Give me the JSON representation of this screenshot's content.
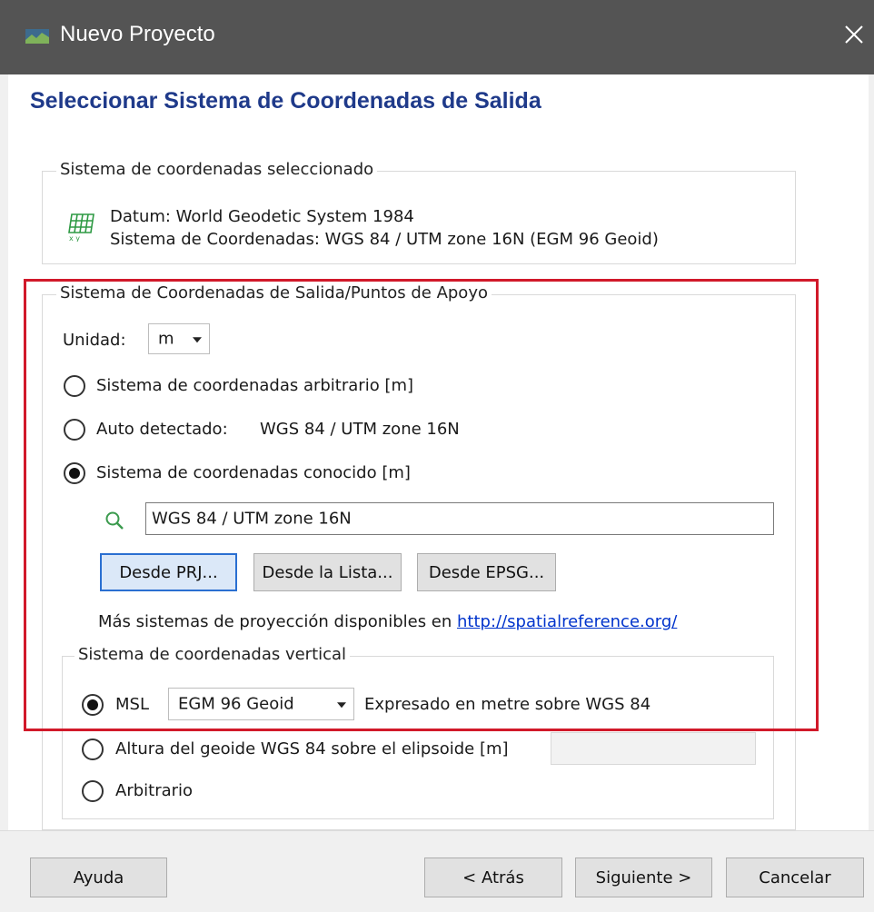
{
  "window": {
    "title": "Nuevo Proyecto"
  },
  "page_title": "Seleccionar Sistema de Coordenadas de Salida",
  "selected_group": {
    "caption": "Sistema de coordenadas seleccionado",
    "datum_line": "Datum: World Geodetic System 1984",
    "cs_line": "Sistema de Coordenadas: WGS 84 / UTM zone 16N (EGM 96 Geoid)",
    "icon": "coordinate-grid-icon"
  },
  "output_group": {
    "caption": "Sistema de Coordenadas de Salida/Puntos de Apoyo",
    "unit_label": "Unidad:",
    "unit_value": "m",
    "options": {
      "arbitrary": "Sistema de coordenadas arbitrario [m]",
      "auto_label": "Auto detectado:",
      "auto_value": "WGS 84 / UTM zone 16N",
      "known": "Sistema de coordenadas conocido [m]"
    },
    "selected_option": "known",
    "search_value": "WGS 84 / UTM zone 16N",
    "buttons": {
      "from_prj": "Desde PRJ...",
      "from_list": "Desde la Lista...",
      "from_epsg": "Desde EPSG..."
    },
    "more_text": "Más sistemas de proyección disponibles en",
    "more_link": "http://spatialreference.org/"
  },
  "vertical_group": {
    "caption": "Sistema de coordenadas vertical",
    "msl_label": "MSL",
    "msl_value": "EGM 96 Geoid",
    "msl_note": "Expresado en metre sobre WGS 84",
    "geoid_label": "Altura del geoide WGS 84 sobre el elipsoide [m]",
    "geoid_value": "",
    "arbitrary_label": "Arbitrario",
    "selected_option": "msl"
  },
  "footer": {
    "help": "Ayuda",
    "back": "< Atrás",
    "next": "Siguiente >",
    "cancel": "Cancelar"
  },
  "colors": {
    "title_bar": "#545454",
    "heading": "#1f3a8a",
    "highlight_box": "#d1192a",
    "link": "#0033cc"
  }
}
